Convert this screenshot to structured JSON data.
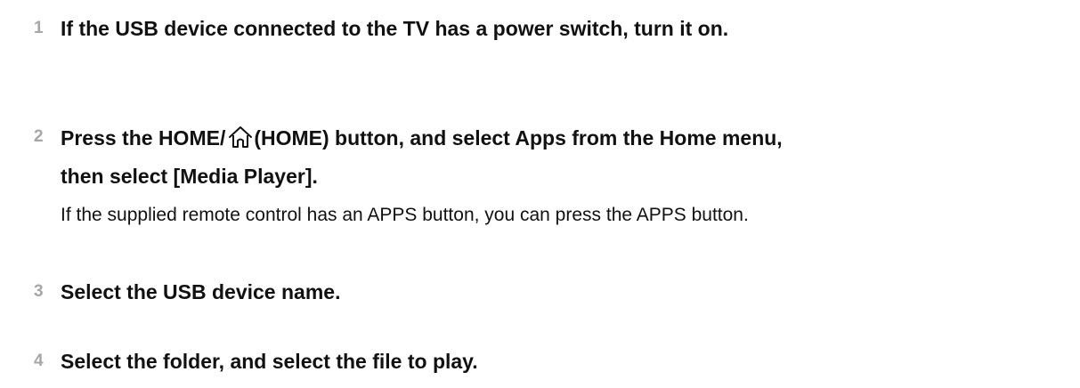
{
  "steps": [
    {
      "number": "1",
      "text": "If the USB device connected to the TV has a power switch, turn it on."
    },
    {
      "number": "2",
      "text_before_icon": "Press the HOME/",
      "icon": "home-icon",
      "text_after_icon": "(HOME) button, and select Apps from the Home menu,",
      "text_line2": "then select [Media Player].",
      "note": "If the supplied remote control has an APPS button, you can press the APPS button."
    },
    {
      "number": "3",
      "text": "Select the USB device name."
    },
    {
      "number": "4",
      "text": "Select the folder, and select the file to play."
    }
  ]
}
